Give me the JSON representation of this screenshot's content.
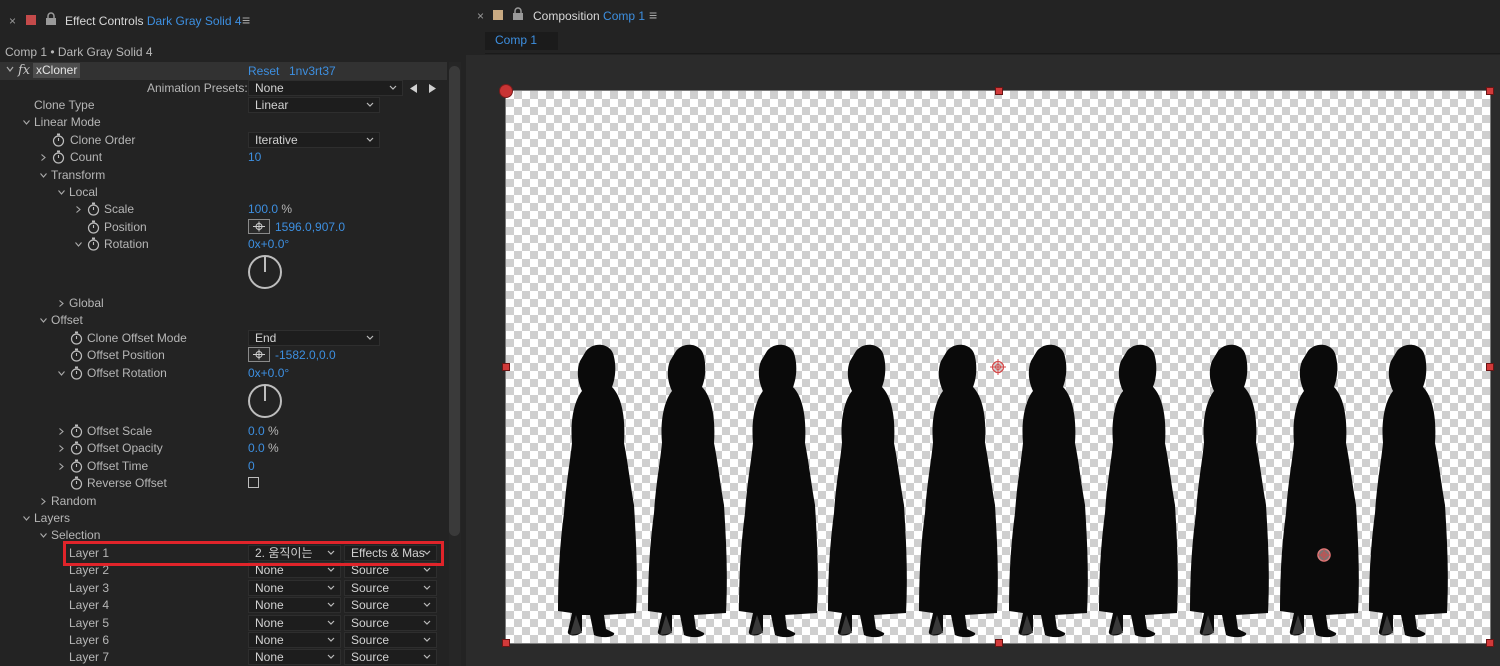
{
  "effect_controls_tab": {
    "prefix": "Effect Controls",
    "layer_name": "Dark Gray Solid 4",
    "menu_glyph": "≡"
  },
  "layer_path": "Comp 1 • Dark Gray Solid 4",
  "effect": {
    "fx_glyph": "fx",
    "name": "xCloner",
    "reset": "Reset",
    "about": "1nv3rt37",
    "animation_presets_label": "Animation Presets:",
    "animation_presets_value": "None"
  },
  "params": {
    "clone_type": {
      "label": "Clone Type",
      "value": "Linear"
    },
    "linear_mode": "Linear Mode",
    "clone_order": {
      "label": "Clone Order",
      "value": "Iterative"
    },
    "count": {
      "label": "Count",
      "value": "10"
    },
    "transform": "Transform",
    "local": "Local",
    "scale": {
      "label": "Scale",
      "value": "100.0",
      "unit": "%"
    },
    "position": {
      "label": "Position",
      "value": "1596.0,907.0"
    },
    "rotation": {
      "label": "Rotation",
      "value": "0x+0.0°"
    },
    "global": "Global",
    "offset": "Offset",
    "clone_offset_mode": {
      "label": "Clone Offset Mode",
      "value": "End"
    },
    "offset_position": {
      "label": "Offset Position",
      "value": "-1582.0,0.0"
    },
    "offset_rotation": {
      "label": "Offset Rotation",
      "value": "0x+0.0°"
    },
    "offset_scale": {
      "label": "Offset Scale",
      "value": "0.0",
      "unit": "%"
    },
    "offset_opacity": {
      "label": "Offset Opacity",
      "value": "0.0",
      "unit": "%"
    },
    "offset_time": {
      "label": "Offset Time",
      "value": "0"
    },
    "reverse_offset": {
      "label": "Reverse Offset",
      "checked": false
    },
    "random": "Random",
    "layers": "Layers",
    "selection": "Selection"
  },
  "layer_rows": [
    {
      "label": "Layer 1",
      "layer": "2. 움직이는",
      "source": "Effects & Mas"
    },
    {
      "label": "Layer 2",
      "layer": "None",
      "source": "Source"
    },
    {
      "label": "Layer 3",
      "layer": "None",
      "source": "Source"
    },
    {
      "label": "Layer 4",
      "layer": "None",
      "source": "Source"
    },
    {
      "label": "Layer 5",
      "layer": "None",
      "source": "Source"
    },
    {
      "label": "Layer 6",
      "layer": "None",
      "source": "Source"
    },
    {
      "label": "Layer 7",
      "layer": "None",
      "source": "Source"
    }
  ],
  "composition_tab": {
    "prefix": "Composition",
    "comp_name": "Comp 1",
    "menu_glyph": "≡",
    "subtab": "Comp 1"
  },
  "colors": {
    "accent_blue": "#3d8fe0",
    "highlight_red": "#e0242a",
    "panel_bg": "#232323"
  }
}
